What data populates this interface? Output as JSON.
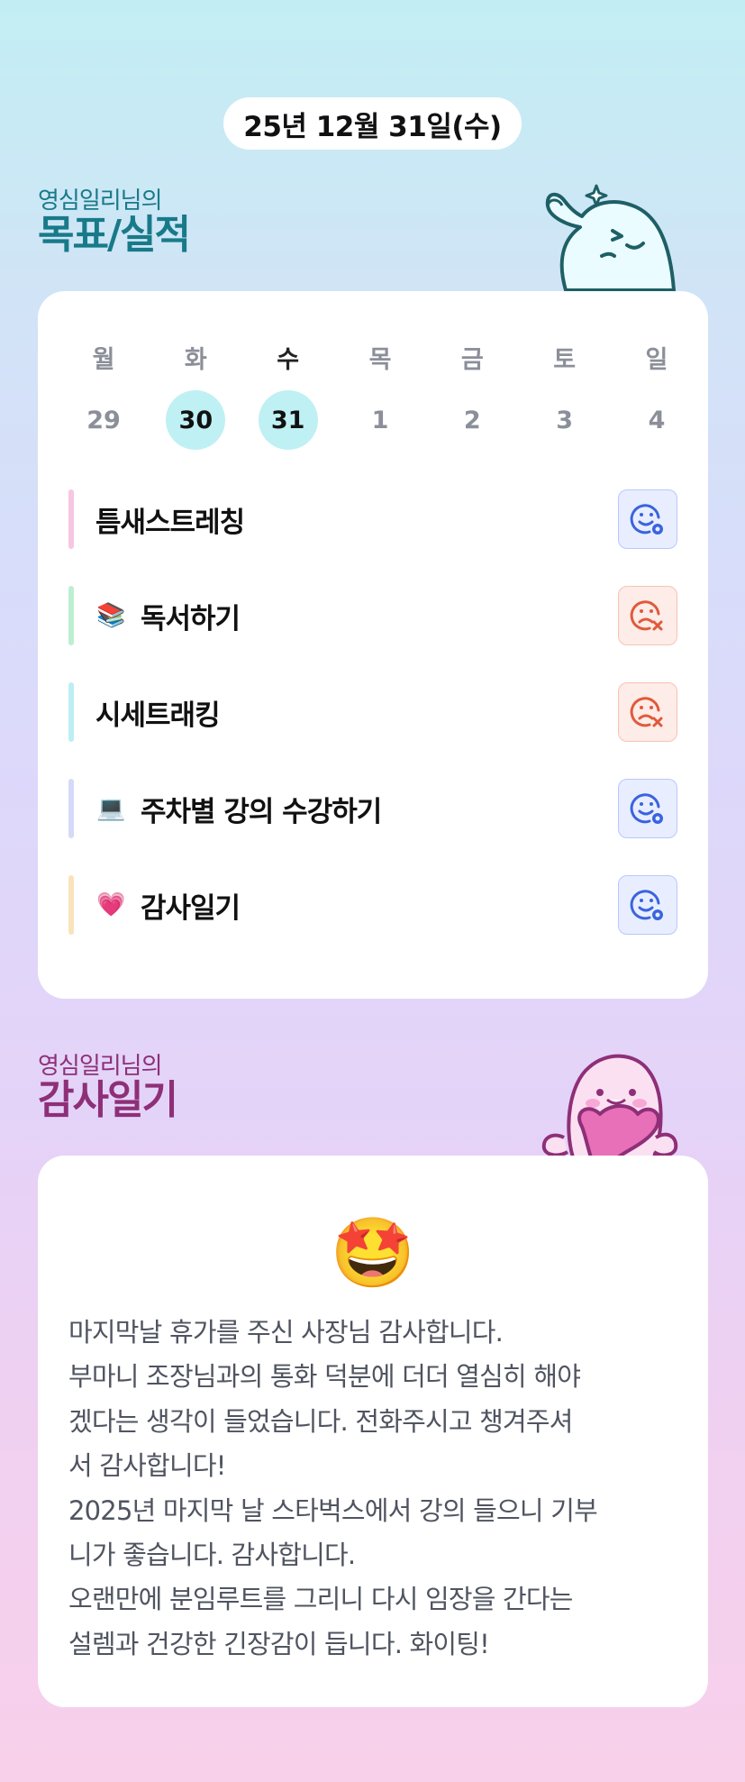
{
  "date": "25년 12월 31일(수)",
  "goals_section": {
    "subtitle": "영심일리님의",
    "title": "목표/실적"
  },
  "week": {
    "days": [
      "월",
      "화",
      "수",
      "목",
      "금",
      "토",
      "일"
    ],
    "dates": [
      "29",
      "30",
      "31",
      "1",
      "2",
      "3",
      "4"
    ],
    "highlighted_dates": [
      "30",
      "31"
    ],
    "current_day": "수"
  },
  "goals": [
    {
      "emoji": "",
      "label": "틈새스트레칭",
      "bar_color": "#f7c6e3",
      "status": "success",
      "icon": "smile-check-icon"
    },
    {
      "emoji": "📚",
      "label": "독서하기",
      "bar_color": "#bdeed1",
      "status": "fail",
      "icon": "sad-x-icon"
    },
    {
      "emoji": "",
      "label": "시세트래킹",
      "bar_color": "#bdeef4",
      "status": "fail",
      "icon": "sad-x-icon"
    },
    {
      "emoji": "💻",
      "label": "주차별 강의 수강하기",
      "bar_color": "#d4daf7",
      "status": "success",
      "icon": "smile-check-icon"
    },
    {
      "emoji": "💗",
      "label": "감사일기",
      "bar_color": "#fae3bc",
      "status": "success",
      "icon": "smile-check-icon"
    }
  ],
  "journal_section": {
    "subtitle": "영심일리님의",
    "title": "감사일기"
  },
  "journal": {
    "mood_emoji": "🤩",
    "lines": [
      "마지막날 휴가를 주신 사장님 감사합니다.",
      "부마니 조장님과의 통화 덕분에 더더 열심히 해야",
      "겠다는 생각이 들었습니다. 전화주시고 챙겨주셔",
      "서 감사합니다!",
      "2025년 마지막 날 스타벅스에서 강의 들으니 기부",
      "니가 좋습니다. 감사합니다.",
      "오랜만에 분임루트를 그리니 다시 임장을 간다는",
      "설렘과 건강한 긴장감이 듭니다. 화이팅!"
    ]
  },
  "colors": {
    "success": "#3a63e0",
    "fail": "#e05a3a",
    "goals_title": "#187a89",
    "journal_title": "#8e2f78"
  }
}
